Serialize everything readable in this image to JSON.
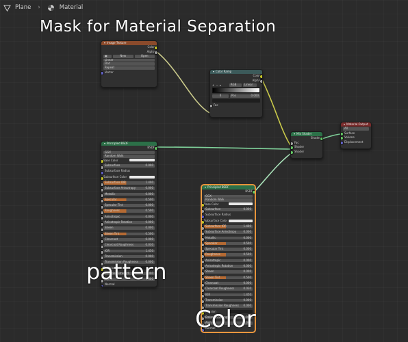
{
  "breadcrumb": {
    "object": "Plane",
    "material": "Material"
  },
  "overlay": {
    "mask_title": "Mask for Material Separation",
    "pattern_label": "pattern",
    "color_label": "Color"
  },
  "colors": {
    "header_texture": "#8a4a2b",
    "header_converter": "#3c5a5a",
    "header_shader": "#2c7048",
    "header_output": "#7a2b2b",
    "link_color": "#b9d4b9",
    "selected_border": "#f0a04a"
  },
  "image_texture": {
    "title": "Image Texture",
    "outputs": [
      "Color",
      "Alpha"
    ],
    "buttons": {
      "new": "New",
      "open": "Open"
    },
    "dropdowns": [
      "Linear",
      "Flat",
      "Repeat"
    ],
    "inputs": [
      "Vector"
    ]
  },
  "color_ramp": {
    "title": "Color Ramp",
    "outputs": [
      "Color",
      "Alpha"
    ],
    "mode": "RGB",
    "interp": "Linear",
    "index": "0",
    "pos_label": "Pos",
    "pos_value": "0.000",
    "inputs": [
      "Fac"
    ]
  },
  "mix_shader": {
    "title": "Mix Shader",
    "output": "Shader",
    "inputs": [
      "Fac",
      "Shader",
      "Shader"
    ]
  },
  "material_output": {
    "title": "Material Output",
    "target": "All",
    "inputs": [
      "Surface",
      "Volume",
      "Displacement"
    ]
  },
  "bsdf_left": {
    "title": "Principled BSDF",
    "output": "BSDF",
    "dropdowns": [
      "GGX",
      "Random Walk"
    ],
    "rows": [
      {
        "label": "Base Color",
        "value": ""
      },
      {
        "label": "Subsurface",
        "value": "0.000"
      },
      {
        "label": "Subsurface Radius",
        "value": ""
      },
      {
        "label": "Subsurface Color",
        "value": ""
      },
      {
        "label": "Subsurface IOR",
        "value": "1.400"
      },
      {
        "label": "Subsurface Anisotropy",
        "value": "0.000"
      },
      {
        "label": "Metallic",
        "value": "0.000"
      },
      {
        "label": "Specular",
        "value": "0.500"
      },
      {
        "label": "Specular Tint",
        "value": "0.000"
      },
      {
        "label": "Roughness",
        "value": "0.500"
      },
      {
        "label": "Anisotropic",
        "value": "0.000"
      },
      {
        "label": "Anisotropic Rotation",
        "value": "0.000"
      },
      {
        "label": "Sheen",
        "value": "0.000"
      },
      {
        "label": "Sheen Tint",
        "value": "0.500"
      },
      {
        "label": "Clearcoat",
        "value": "0.000"
      },
      {
        "label": "Clearcoat Roughness",
        "value": "0.030"
      },
      {
        "label": "IOR",
        "value": "1.450"
      },
      {
        "label": "Transmission",
        "value": "0.000"
      },
      {
        "label": "Transmission Roughness",
        "value": "0.000"
      },
      {
        "label": "Emission",
        "value": ""
      },
      {
        "label": "Emission Strength",
        "value": "1.000"
      },
      {
        "label": "Alpha",
        "value": "1.000"
      },
      {
        "label": "Normal",
        "value": ""
      },
      {
        "label": "Clearcoat Normal",
        "value": ""
      },
      {
        "label": "Tangent",
        "value": ""
      }
    ]
  },
  "bsdf_right": {
    "title": "Principled BSDF",
    "output": "BSDF",
    "dropdowns": [
      "GGX",
      "Random Walk"
    ],
    "rows": [
      {
        "label": "Base Color",
        "value": ""
      },
      {
        "label": "Subsurface",
        "value": "0.000"
      },
      {
        "label": "Subsurface Radius",
        "value": ""
      },
      {
        "label": "Subsurface Color",
        "value": ""
      },
      {
        "label": "Subsurface IOR",
        "value": "1.400"
      },
      {
        "label": "Subsurface Anisotropy",
        "value": "0.000"
      },
      {
        "label": "Metallic",
        "value": "0.000"
      },
      {
        "label": "Specular",
        "value": "0.500"
      },
      {
        "label": "Specular Tint",
        "value": "0.000"
      },
      {
        "label": "Roughness",
        "value": "0.500"
      },
      {
        "label": "Anisotropic",
        "value": "0.000"
      },
      {
        "label": "Anisotropic Rotation",
        "value": "0.000"
      },
      {
        "label": "Sheen",
        "value": "0.000"
      },
      {
        "label": "Sheen Tint",
        "value": "0.500"
      },
      {
        "label": "Clearcoat",
        "value": "0.000"
      },
      {
        "label": "Clearcoat Roughness",
        "value": "0.030"
      },
      {
        "label": "IOR",
        "value": "1.450"
      },
      {
        "label": "Transmission",
        "value": "0.000"
      },
      {
        "label": "Transmission Roughness",
        "value": "0.000"
      },
      {
        "label": "Emission",
        "value": ""
      },
      {
        "label": "Emission Strength",
        "value": "1.000"
      },
      {
        "label": "Alpha",
        "value": "1.000"
      },
      {
        "label": "Normal",
        "value": ""
      },
      {
        "label": "Clearcoat Normal",
        "value": ""
      }
    ]
  }
}
